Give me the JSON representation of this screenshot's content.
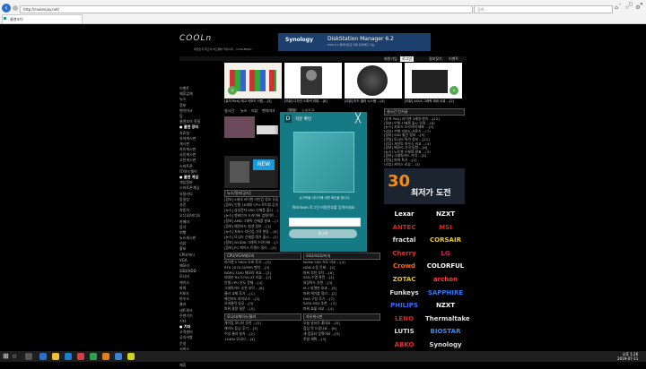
{
  "browser": {
    "address": "http://coolenjoy.net/",
    "search_placeholder": "검색...",
    "tab_title": "쿨엔조이"
  },
  "site": {
    "logo": "COOLn",
    "logo_sub": "대한민국 최고의 하드웨어 커뮤니티 - COOLENJOY",
    "banner": {
      "brand": "Synology",
      "title": "DiskStation Manager 6.2",
      "sub": "DSM 6.2 업데이트로 더욱 강력해진 기능"
    },
    "top_links": [
      "회원가입",
      "로그인",
      "정보찾기",
      "이벤트"
    ]
  },
  "sidebar": {
    "items": [
      "이벤트",
      "제휴업체",
      "뉴스",
      "정보",
      "벤치마크",
      "팁",
      "쿨엔조이 핫딜",
      "● 쿨엔 장터",
      "자료실",
      "유저게시판",
      "게시판",
      "자유게시판",
      "사진게시판",
      "고민게시판",
      "스마트폰",
      "IT/하드웨어",
      "● 쿨엔 게임",
      "게임정보",
      "스마트폰게임",
      "유틸리티",
      "동영상",
      "사진",
      "자동차",
      "오디오/비디오",
      "카메라",
      "음악",
      "여행",
      "뉴스게시판",
      "리뷰",
      "홍보",
      "CPU/마더",
      "VGA",
      "메모리",
      "SSD/HDD",
      "모니터",
      "케이스",
      "파워",
      "키보드",
      "마우스",
      "쿨러",
      "네트워크",
      "주변기기",
      "기타",
      "● 기타",
      "고객센터",
      "공지사항",
      "운영",
      "서비스",
      "문의",
      "광고",
      "제휴"
    ]
  },
  "thumbs": [
    {
      "caption": "[유저 Pick] 레고 키보드 키캡 ...[3]"
    },
    {
      "caption": "[리뷰] 디자인 스피커 리뷰 ...[8]"
    },
    {
      "caption": "[리뷰] 미드 쿨러 시스템 ...[4]"
    },
    {
      "caption": "[리뷰] ASUS 그래픽 파워 리뷰 ...[2]"
    }
  ],
  "nav": [
    "실시간",
    "뉴스",
    "리뷰",
    "벤치마크",
    "핫딜",
    "스마트폰"
  ],
  "modal": {
    "logo": "D",
    "title": "지문 확인",
    "close": "╳",
    "info": "손가락을 리더기에 대면 확인을 합니다.",
    "hint": "Windows 로그인 비밀번호를 입력하세요",
    "input_value": "",
    "button": "로그인"
  },
  "center": {
    "news_header": "뉴스/정보[공지]",
    "news_lines": [
      "[정보] 5세대 라이젠 라인업 정보 유출 ...[4]",
      "[정보] 인텔 10세대 CPU 로드맵 공개 ...[7]",
      "[뉴스] 삼성전자 SSD 신제품 출시 ...[2]",
      "[뉴스] 엔비디아 드라이버 업데이트 ...[5]",
      "[정보] AMD 그래픽 신제품 발표 ...[3]",
      "[정보] 메인보드 칩셋 정보 ...[1]",
      "[뉴스] 지포스 라인업 가격 변동 ...[6]",
      "[뉴스] 모니터 신제품 대거 출시 ...[2]",
      "[정보] NVIDIA 그래픽 드라이버 ...[3]",
      "[정보] PC 케이스 트렌드 정리 ...[4]"
    ],
    "cpu_header": "CPU/VGA/메모리",
    "cpu_lines": [
      "라이젠 5 3600 오버 후기 ...[5]",
      "RTX 2070 SUPER 벤치 ...[3]",
      "DDR4 3200 메모리 비교 ...[2]",
      "라데온 RX 5700 XT 리뷰 ...[7]",
      "인텔 CPU 온도 문제 ...[4]",
      "그래픽카드 추천 부탁 ...[6]",
      "쿨러 교체 후기 ...[1]",
      "메인보드 바이오스 ...[2]",
      "오버클럭 성공 ...[3]",
      "파워 용량 질문 ...[5]"
    ],
    "ssd_header": "SSD/HDD/파워",
    "ssd_lines": [
      "NVMe SSD 속도 비교 ...[4]",
      "HDD 소음 문제 ...[2]",
      "파워 추천 부탁 ...[6]",
      "SSD 수명 관련 ...[1]",
      "외장하드 추천 ...[3]",
      "M.2 방열판 효과 ...[5]",
      "파워 케이블 정리 ...[2]",
      "NAS 구성 후기 ...[7]",
      "SATA SSD 추천 ...[3]",
      "파워 효율 비교 ...[4]"
    ],
    "etc_header": "모니터/케이스/쿨러",
    "etc_lines": [
      "게이밍 모니터 추천 ...[5]",
      "케이스 튜닝 후기 ...[3]",
      "수냉 쿨러 설치 ...[2]",
      "144Hz 모니터 ...[4]"
    ],
    "free_header": "자유게시판",
    "free_lines": [
      "오늘 날씨가 좋네요 ...[8]",
      "점심 뭐 드셨나요 ...[6]",
      "새 컴퓨터 맞췄어요 ...[9]",
      "주말 계획 ...[3]"
    ]
  },
  "right": {
    "header": "실시간 인기글",
    "lines": [
      "[유저 Pick] 라이젠 3세대 벤치 ...[12]",
      "[정보] 인텔 신제품 출시 일정 ...[8]",
      "[뉴스] 지포스 드라이버 배포 ...[5]",
      "[리뷰] 신형 키보드 사용기 ...[7]",
      "[정보] SSD 할인 정보 ...[9]",
      "[핫딜] 모니터 특가 정보 ...[11]",
      "[리뷰] 게이밍 마우스 비교 ...[4]",
      "[정보] 메모리 가격 동향 ...[6]",
      "[뉴스] 노트북 신제품 발표 ...[3]",
      "[정보] 그래픽카드 가격 ...[5]",
      "[핫딜] 파워 특가 ...[2]",
      "[리뷰] 케이스 리뷰 ...[3]"
    ],
    "ad_number": "30",
    "ad_text": "최저가 도전"
  },
  "brands": [
    {
      "name": "Lexar",
      "color": "#ffffff"
    },
    {
      "name": "NZXT",
      "color": "#ffffff"
    },
    {
      "name": "ANTEC",
      "color": "#e02020"
    },
    {
      "name": "MSI",
      "color": "#e02020"
    },
    {
      "name": "fractal",
      "color": "#dddddd"
    },
    {
      "name": "CORSAIR",
      "color": "#f5d000"
    },
    {
      "name": "Cherry",
      "color": "#e03030"
    },
    {
      "name": "LG",
      "color": "#c0206a"
    },
    {
      "name": "Crowd",
      "color": "#ff6a00"
    },
    {
      "name": "COLORFUL",
      "color": "#ffffff"
    },
    {
      "name": "ZOTAC",
      "color": "#f0c000"
    },
    {
      "name": "archon",
      "color": "#f04040"
    },
    {
      "name": "Funkeys",
      "color": "#dddddd"
    },
    {
      "name": "SAPPHIRE",
      "color": "#2a7af0"
    },
    {
      "name": "PHILIPS",
      "color": "#3a6af0"
    },
    {
      "name": "NZXT",
      "color": "#ffffff"
    },
    {
      "name": "LENO",
      "color": "#e02020"
    },
    {
      "name": "Thermaltake",
      "color": "#dddddd"
    },
    {
      "name": "LUTIS",
      "color": "#dddddd"
    },
    {
      "name": "BIOSTAR",
      "color": "#3a8af0"
    },
    {
      "name": "ABKO",
      "color": "#e03030"
    },
    {
      "name": "Synology",
      "color": "#dddddd"
    }
  ],
  "taskbar": {
    "search": "○",
    "time": "오후 1:26",
    "date": "2019-07-11"
  }
}
